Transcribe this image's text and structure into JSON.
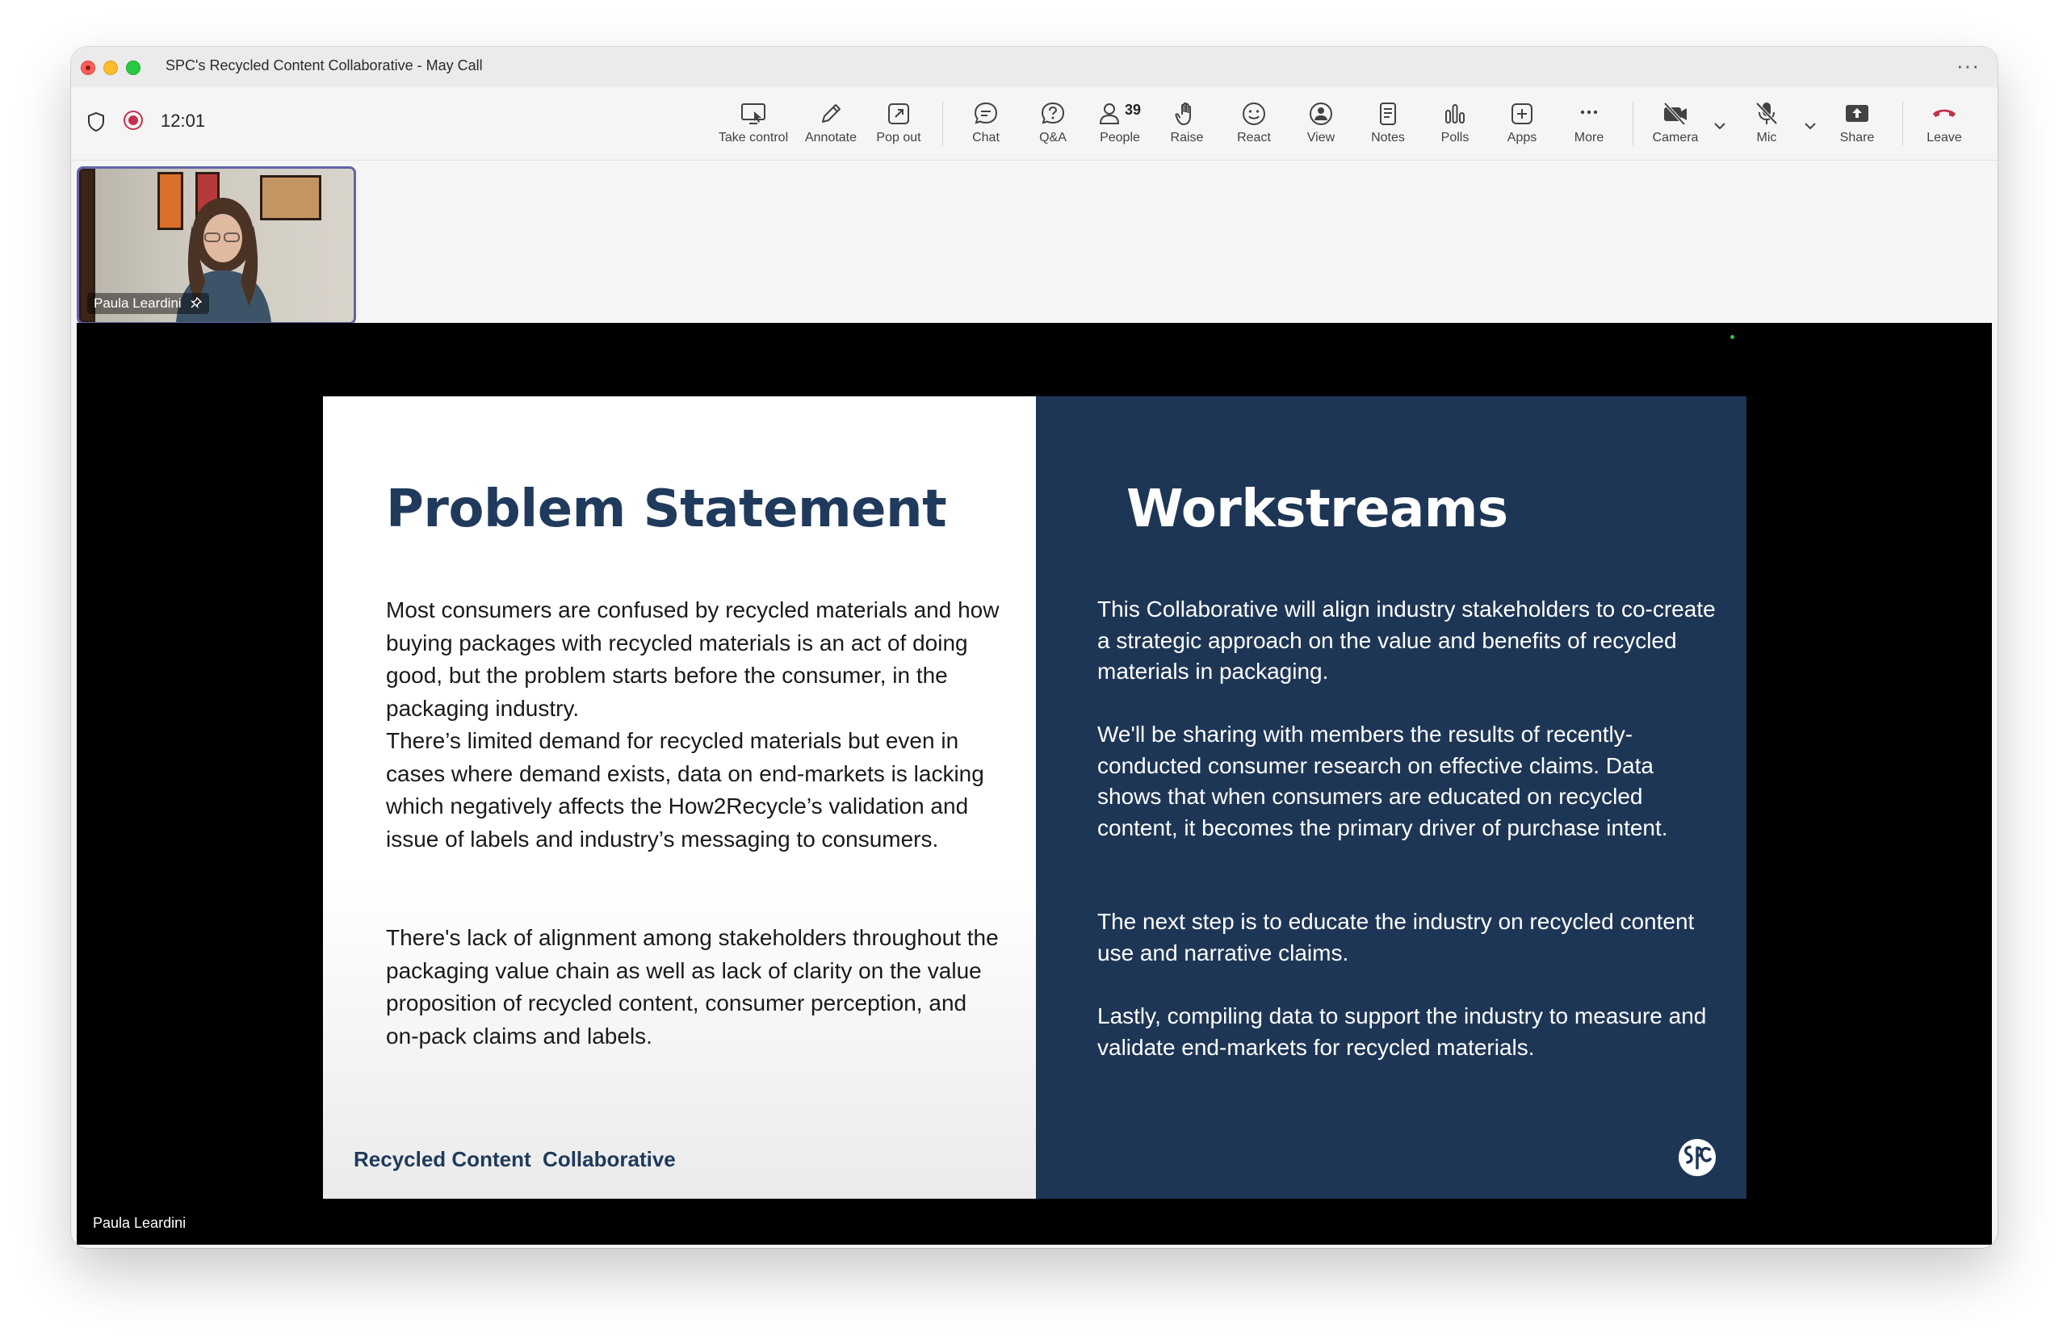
{
  "window": {
    "title": "SPC's Recycled Content Collaborative - May Call",
    "more_glyph": "···"
  },
  "toolbar": {
    "timer": "12:01",
    "buttons": {
      "take_control": "Take control",
      "annotate": "Annotate",
      "pop_out": "Pop out",
      "chat": "Chat",
      "qa": "Q&A",
      "people": "People",
      "people_count": "39",
      "raise": "Raise",
      "react": "React",
      "view": "View",
      "notes": "Notes",
      "polls": "Polls",
      "apps": "Apps",
      "more": "More",
      "camera": "Camera",
      "mic": "Mic",
      "share": "Share",
      "leave": "Leave"
    },
    "colors": {
      "leave": "#c4314b",
      "recording": "#c4314b",
      "accent": "#6264a7"
    }
  },
  "participant": {
    "name": "Paula Leardini"
  },
  "stage": {
    "presenter_name": "Paula Leardini"
  },
  "slide": {
    "left": {
      "heading": "Problem Statement",
      "paragraphs": [
        "Most consumers are confused by recycled materials and how buying packages with recycled materials is an act of doing good, but the problem starts before the consumer, in the packaging industry.",
        "There’s limited demand for recycled materials but even in cases where demand exists, data on end-markets is lacking which negatively affects the How2Recycle’s validation and issue of labels and industry’s messaging to consumers.",
        "There's lack of alignment among stakeholders throughout the packaging value chain as well as lack of clarity on the value proposition of recycled content, consumer perception, and on-pack claims and labels."
      ],
      "footer": "Recycled Content  Collaborative"
    },
    "right": {
      "heading": "Workstreams",
      "paragraphs": [
        "This Collaborative will align industry stakeholders to co-create a strategic approach on the value and benefits of recycled materials in packaging.",
        "We'll be sharing with members the results of recently-conducted consumer research on effective claims. Data shows that when consumers are educated on recycled content, it becomes the primary driver of purchase intent.",
        "The next step is to educate the industry on recycled content use and narrative claims.",
        "Lastly, compiling data to support the industry to measure and validate end-markets for recycled materials."
      ],
      "logo_icon": "spc-logo-icon"
    },
    "colors": {
      "left_bg": "#ffffff",
      "right_bg": "#1e3656",
      "heading_navy": "#1f3a5c"
    }
  }
}
